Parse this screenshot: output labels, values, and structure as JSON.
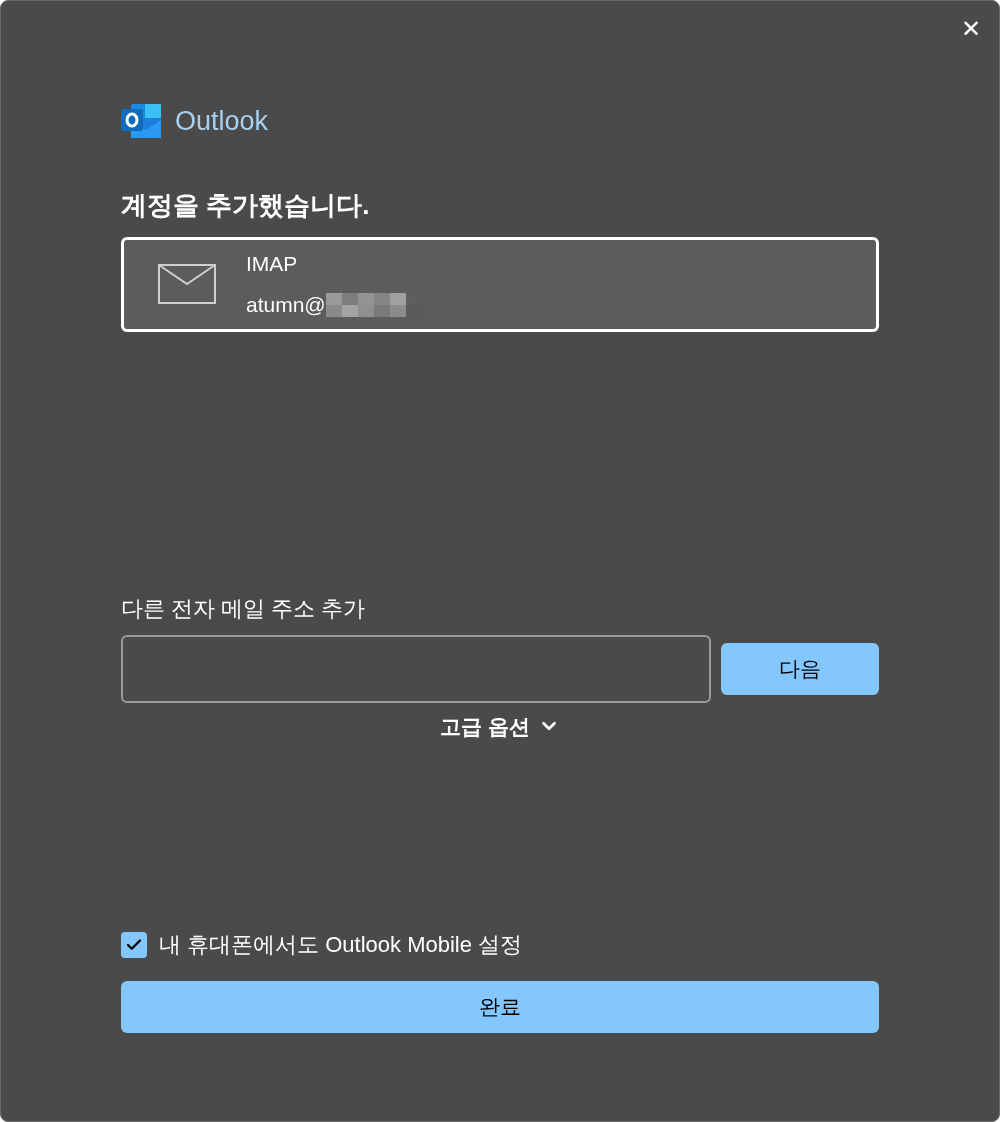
{
  "close_button": {
    "label": "✕"
  },
  "brand": {
    "name": "Outlook"
  },
  "heading": "계정을 추가했습니다.",
  "account": {
    "type": "IMAP",
    "email": "atumn@",
    "selected": true
  },
  "add_email": {
    "label": "다른 전자 메일 주소 추가",
    "next_button": "다음"
  },
  "advanced_options": {
    "label": "고급 옵션",
    "expanded": false
  },
  "mobile_setup": {
    "label": "내 휴대폰에서도 Outlook Mobile 설정",
    "checked": true
  },
  "done_button": "완료"
}
